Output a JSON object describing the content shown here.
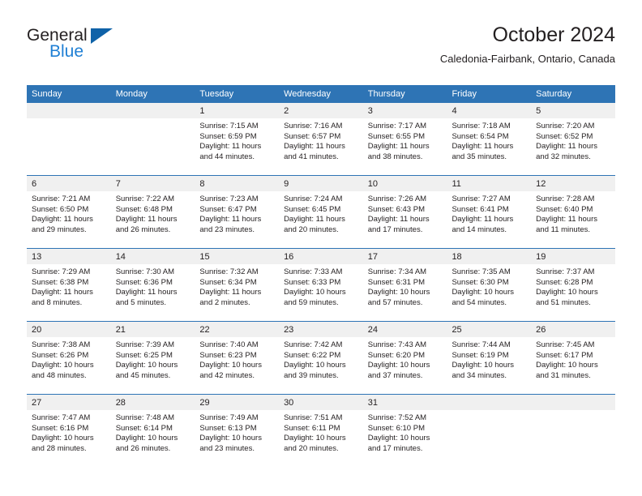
{
  "brand": {
    "name_top": "General",
    "name_bottom": "Blue",
    "triangle_color": "#0f62a8",
    "blue_text_color": "#1f7fd4"
  },
  "header": {
    "title": "October 2024",
    "subtitle": "Caledonia-Fairbank, Ontario, Canada",
    "header_bg_color": "#2e74b5",
    "daynum_bg_color": "#f0f0f0"
  },
  "weekday_headers": [
    "Sunday",
    "Monday",
    "Tuesday",
    "Wednesday",
    "Thursday",
    "Friday",
    "Saturday"
  ],
  "weeks": [
    {
      "days": [
        {
          "num": "",
          "lines": []
        },
        {
          "num": "",
          "lines": []
        },
        {
          "num": "1",
          "lines": [
            "Sunrise: 7:15 AM",
            "Sunset: 6:59 PM",
            "Daylight: 11 hours",
            "and 44 minutes."
          ]
        },
        {
          "num": "2",
          "lines": [
            "Sunrise: 7:16 AM",
            "Sunset: 6:57 PM",
            "Daylight: 11 hours",
            "and 41 minutes."
          ]
        },
        {
          "num": "3",
          "lines": [
            "Sunrise: 7:17 AM",
            "Sunset: 6:55 PM",
            "Daylight: 11 hours",
            "and 38 minutes."
          ]
        },
        {
          "num": "4",
          "lines": [
            "Sunrise: 7:18 AM",
            "Sunset: 6:54 PM",
            "Daylight: 11 hours",
            "and 35 minutes."
          ]
        },
        {
          "num": "5",
          "lines": [
            "Sunrise: 7:20 AM",
            "Sunset: 6:52 PM",
            "Daylight: 11 hours",
            "and 32 minutes."
          ]
        }
      ]
    },
    {
      "days": [
        {
          "num": "6",
          "lines": [
            "Sunrise: 7:21 AM",
            "Sunset: 6:50 PM",
            "Daylight: 11 hours",
            "and 29 minutes."
          ]
        },
        {
          "num": "7",
          "lines": [
            "Sunrise: 7:22 AM",
            "Sunset: 6:48 PM",
            "Daylight: 11 hours",
            "and 26 minutes."
          ]
        },
        {
          "num": "8",
          "lines": [
            "Sunrise: 7:23 AM",
            "Sunset: 6:47 PM",
            "Daylight: 11 hours",
            "and 23 minutes."
          ]
        },
        {
          "num": "9",
          "lines": [
            "Sunrise: 7:24 AM",
            "Sunset: 6:45 PM",
            "Daylight: 11 hours",
            "and 20 minutes."
          ]
        },
        {
          "num": "10",
          "lines": [
            "Sunrise: 7:26 AM",
            "Sunset: 6:43 PM",
            "Daylight: 11 hours",
            "and 17 minutes."
          ]
        },
        {
          "num": "11",
          "lines": [
            "Sunrise: 7:27 AM",
            "Sunset: 6:41 PM",
            "Daylight: 11 hours",
            "and 14 minutes."
          ]
        },
        {
          "num": "12",
          "lines": [
            "Sunrise: 7:28 AM",
            "Sunset: 6:40 PM",
            "Daylight: 11 hours",
            "and 11 minutes."
          ]
        }
      ]
    },
    {
      "days": [
        {
          "num": "13",
          "lines": [
            "Sunrise: 7:29 AM",
            "Sunset: 6:38 PM",
            "Daylight: 11 hours",
            "and 8 minutes."
          ]
        },
        {
          "num": "14",
          "lines": [
            "Sunrise: 7:30 AM",
            "Sunset: 6:36 PM",
            "Daylight: 11 hours",
            "and 5 minutes."
          ]
        },
        {
          "num": "15",
          "lines": [
            "Sunrise: 7:32 AM",
            "Sunset: 6:34 PM",
            "Daylight: 11 hours",
            "and 2 minutes."
          ]
        },
        {
          "num": "16",
          "lines": [
            "Sunrise: 7:33 AM",
            "Sunset: 6:33 PM",
            "Daylight: 10 hours",
            "and 59 minutes."
          ]
        },
        {
          "num": "17",
          "lines": [
            "Sunrise: 7:34 AM",
            "Sunset: 6:31 PM",
            "Daylight: 10 hours",
            "and 57 minutes."
          ]
        },
        {
          "num": "18",
          "lines": [
            "Sunrise: 7:35 AM",
            "Sunset: 6:30 PM",
            "Daylight: 10 hours",
            "and 54 minutes."
          ]
        },
        {
          "num": "19",
          "lines": [
            "Sunrise: 7:37 AM",
            "Sunset: 6:28 PM",
            "Daylight: 10 hours",
            "and 51 minutes."
          ]
        }
      ]
    },
    {
      "days": [
        {
          "num": "20",
          "lines": [
            "Sunrise: 7:38 AM",
            "Sunset: 6:26 PM",
            "Daylight: 10 hours",
            "and 48 minutes."
          ]
        },
        {
          "num": "21",
          "lines": [
            "Sunrise: 7:39 AM",
            "Sunset: 6:25 PM",
            "Daylight: 10 hours",
            "and 45 minutes."
          ]
        },
        {
          "num": "22",
          "lines": [
            "Sunrise: 7:40 AM",
            "Sunset: 6:23 PM",
            "Daylight: 10 hours",
            "and 42 minutes."
          ]
        },
        {
          "num": "23",
          "lines": [
            "Sunrise: 7:42 AM",
            "Sunset: 6:22 PM",
            "Daylight: 10 hours",
            "and 39 minutes."
          ]
        },
        {
          "num": "24",
          "lines": [
            "Sunrise: 7:43 AM",
            "Sunset: 6:20 PM",
            "Daylight: 10 hours",
            "and 37 minutes."
          ]
        },
        {
          "num": "25",
          "lines": [
            "Sunrise: 7:44 AM",
            "Sunset: 6:19 PM",
            "Daylight: 10 hours",
            "and 34 minutes."
          ]
        },
        {
          "num": "26",
          "lines": [
            "Sunrise: 7:45 AM",
            "Sunset: 6:17 PM",
            "Daylight: 10 hours",
            "and 31 minutes."
          ]
        }
      ]
    },
    {
      "days": [
        {
          "num": "27",
          "lines": [
            "Sunrise: 7:47 AM",
            "Sunset: 6:16 PM",
            "Daylight: 10 hours",
            "and 28 minutes."
          ]
        },
        {
          "num": "28",
          "lines": [
            "Sunrise: 7:48 AM",
            "Sunset: 6:14 PM",
            "Daylight: 10 hours",
            "and 26 minutes."
          ]
        },
        {
          "num": "29",
          "lines": [
            "Sunrise: 7:49 AM",
            "Sunset: 6:13 PM",
            "Daylight: 10 hours",
            "and 23 minutes."
          ]
        },
        {
          "num": "30",
          "lines": [
            "Sunrise: 7:51 AM",
            "Sunset: 6:11 PM",
            "Daylight: 10 hours",
            "and 20 minutes."
          ]
        },
        {
          "num": "31",
          "lines": [
            "Sunrise: 7:52 AM",
            "Sunset: 6:10 PM",
            "Daylight: 10 hours",
            "and 17 minutes."
          ]
        },
        {
          "num": "",
          "lines": []
        },
        {
          "num": "",
          "lines": []
        }
      ]
    }
  ]
}
